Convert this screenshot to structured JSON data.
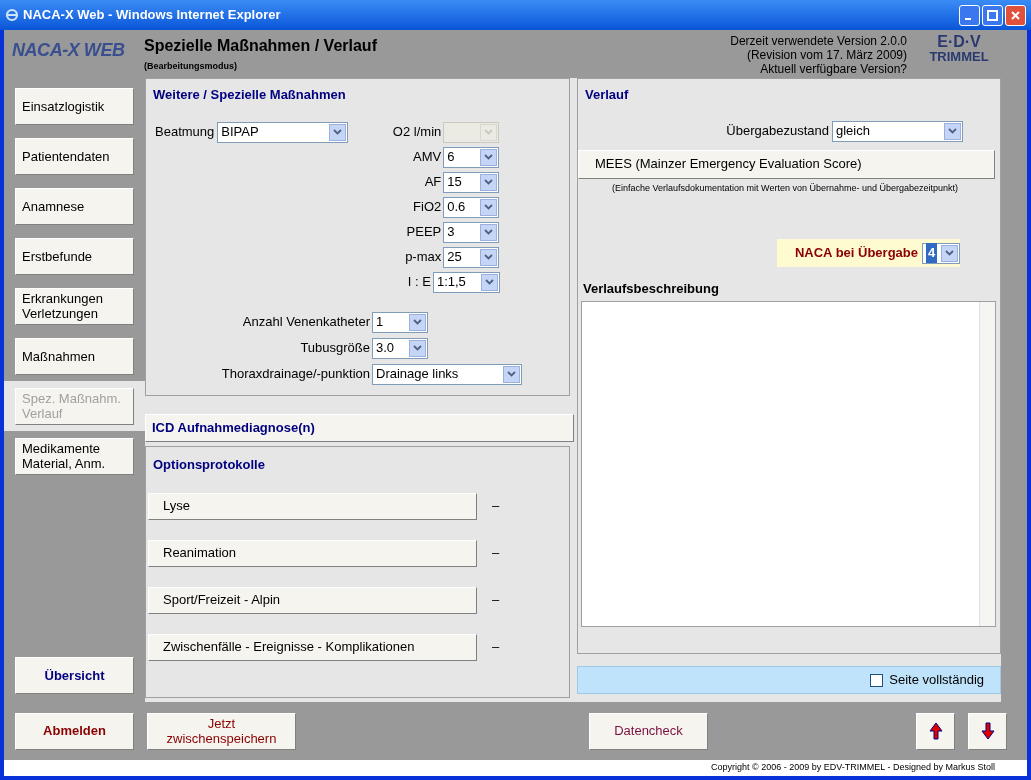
{
  "window": {
    "title": "NACA-X Web - Windows Internet Explorer"
  },
  "header": {
    "logo": "NACA-X WEB",
    "title": "Spezielle Maßnahmen / Verlauf",
    "subtitle": "(Bearbeitungsmodus)",
    "version_lines": [
      "Derzeit verwendete Version 2.0.0",
      "(Revision vom 17. März 2009)",
      "Aktuell verfügbare Version?"
    ],
    "brand_logo": {
      "top": "E·D·V",
      "bottom": "TRIMMEL"
    }
  },
  "sidebar": {
    "items": [
      {
        "label": "Einsatzlogistik",
        "selected": false
      },
      {
        "label": "Patientendaten",
        "selected": false
      },
      {
        "label": "Anamnese",
        "selected": false
      },
      {
        "label": "Erstbefunde",
        "selected": false
      },
      {
        "label": "Erkrankungen Verletzungen",
        "selected": false
      },
      {
        "label": "Maßnahmen",
        "selected": false
      },
      {
        "label": "Spez. Maßnahm. Verlauf",
        "selected": true
      },
      {
        "label": "Medikamente Material, Anm.",
        "selected": false
      }
    ],
    "overview_button": "Übersicht"
  },
  "measures": {
    "title": "Weitere / Spezielle Maßnahmen",
    "ventilation": {
      "label": "Beatmung",
      "value": "BIPAP",
      "disabled": false
    },
    "vent_params": [
      {
        "label": "O2 l/min",
        "disabled": true
      },
      {
        "label": "AMV",
        "value": "6",
        "disabled": false
      },
      {
        "label": "AF",
        "value": "15",
        "disabled": false
      },
      {
        "label": "FiO2",
        "value": "0.6",
        "disabled": false
      },
      {
        "label": "PEEP",
        "value": "3",
        "disabled": false
      },
      {
        "label": "p-max",
        "value": "25",
        "disabled": false
      },
      {
        "label": "I : E",
        "value": "1:1,5",
        "disabled": false,
        "wide": true
      }
    ],
    "other_fields": [
      {
        "label": "Anzahl Venenkatheter",
        "value": "1",
        "wide": false
      },
      {
        "label": "Tubusgröße",
        "value": "3.0",
        "wide": false
      },
      {
        "label": "Thoraxdrainage/-punktion",
        "value": "Drainage links",
        "wide": true
      }
    ]
  },
  "icd_button": "ICD Aufnahmediagnose(n)",
  "option_protocols": {
    "title": "Optionsprotokolle",
    "items": [
      {
        "label": "Lyse",
        "status": "–"
      },
      {
        "label": "Reanimation",
        "status": "–"
      },
      {
        "label": "Sport/Freizeit - Alpin",
        "status": "–"
      },
      {
        "label": "Zwischenfälle - Ereignisse - Komplikationen",
        "status": "–"
      }
    ]
  },
  "course": {
    "title": "Verlauf",
    "handover_state": {
      "label": "Übergabezustand",
      "value": "gleich"
    },
    "mees_button": "MEES  (Mainzer Emergency Evaluation Score)",
    "mees_note": "(Einfache Verlaufsdokumentation mit Werten von Übernahme- und Übergabezeitpunkt)",
    "naca": {
      "label": "NACA bei Übergabe",
      "value": "4"
    },
    "description_label": "Verlaufsbeschreibung"
  },
  "page_complete": {
    "label": "Seite vollständig",
    "checked": false
  },
  "bottom_bar": {
    "logout": "Abmelden",
    "save": "Jetzt zwischenspeichern",
    "check": "Datencheck"
  },
  "footer": "Copyright © 2006 - 2009 by EDV-TRIMMEL - Designed by Markus Stoll"
}
